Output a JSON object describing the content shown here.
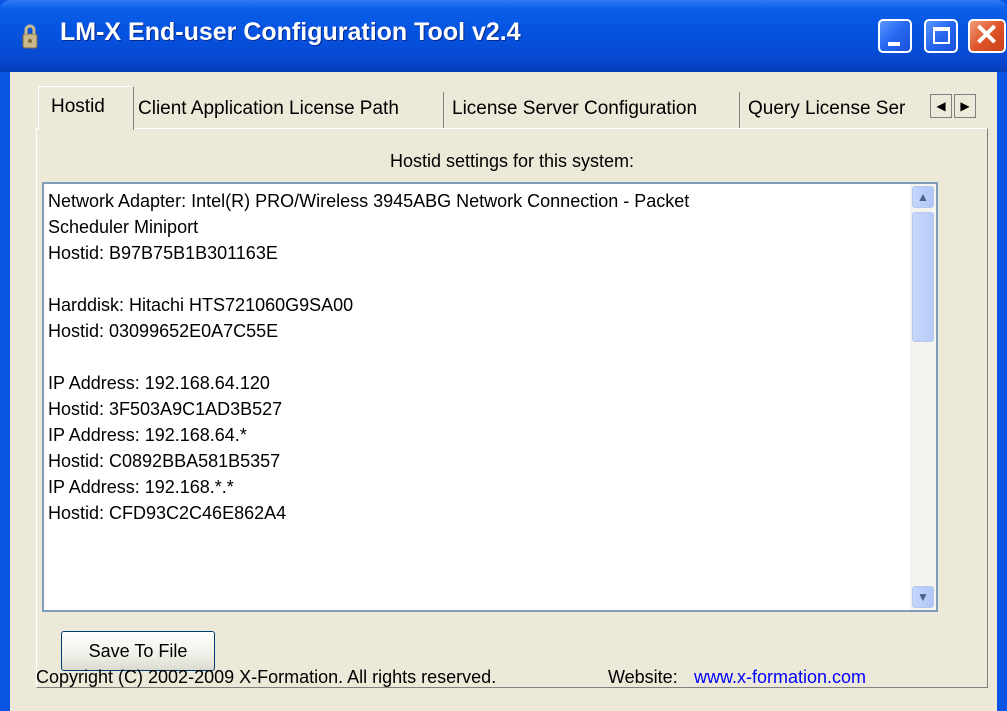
{
  "window": {
    "title": "LM-X End-user Configuration Tool v2.4",
    "icon": "lock-icon"
  },
  "tabs": [
    {
      "label": "Hostid",
      "active": true
    },
    {
      "label": "Client Application License Path",
      "active": false
    },
    {
      "label": "License Server Configuration",
      "active": false
    },
    {
      "label": "Query License Ser",
      "active": false
    }
  ],
  "hostid_panel": {
    "heading": "Hostid settings for this system:",
    "content": "Network Adapter: Intel(R) PRO/Wireless 3945ABG Network Connection - Packet\nScheduler Miniport\nHostid: B97B75B1B301163E\n\nHarddisk: Hitachi HTS721060G9SA00\nHostid: 03099652E0A7C55E\n\nIP Address: 192.168.64.120\nHostid: 3F503A9C1AD3B527\nIP Address: 192.168.64.*\nHostid: C0892BBA581B5357\nIP Address: 192.168.*.*\nHostid: CFD93C2C46E862A4",
    "save_button": "Save To File"
  },
  "footer": {
    "copyright": "Copyright (C) 2002-2009 X-Formation. All rights reserved.",
    "website_label": "Website:",
    "website_link": "www.x-formation.com"
  },
  "colors": {
    "titlebar": "#0553e0",
    "window_bg": "#ece9d8",
    "link": "#0000ff"
  }
}
